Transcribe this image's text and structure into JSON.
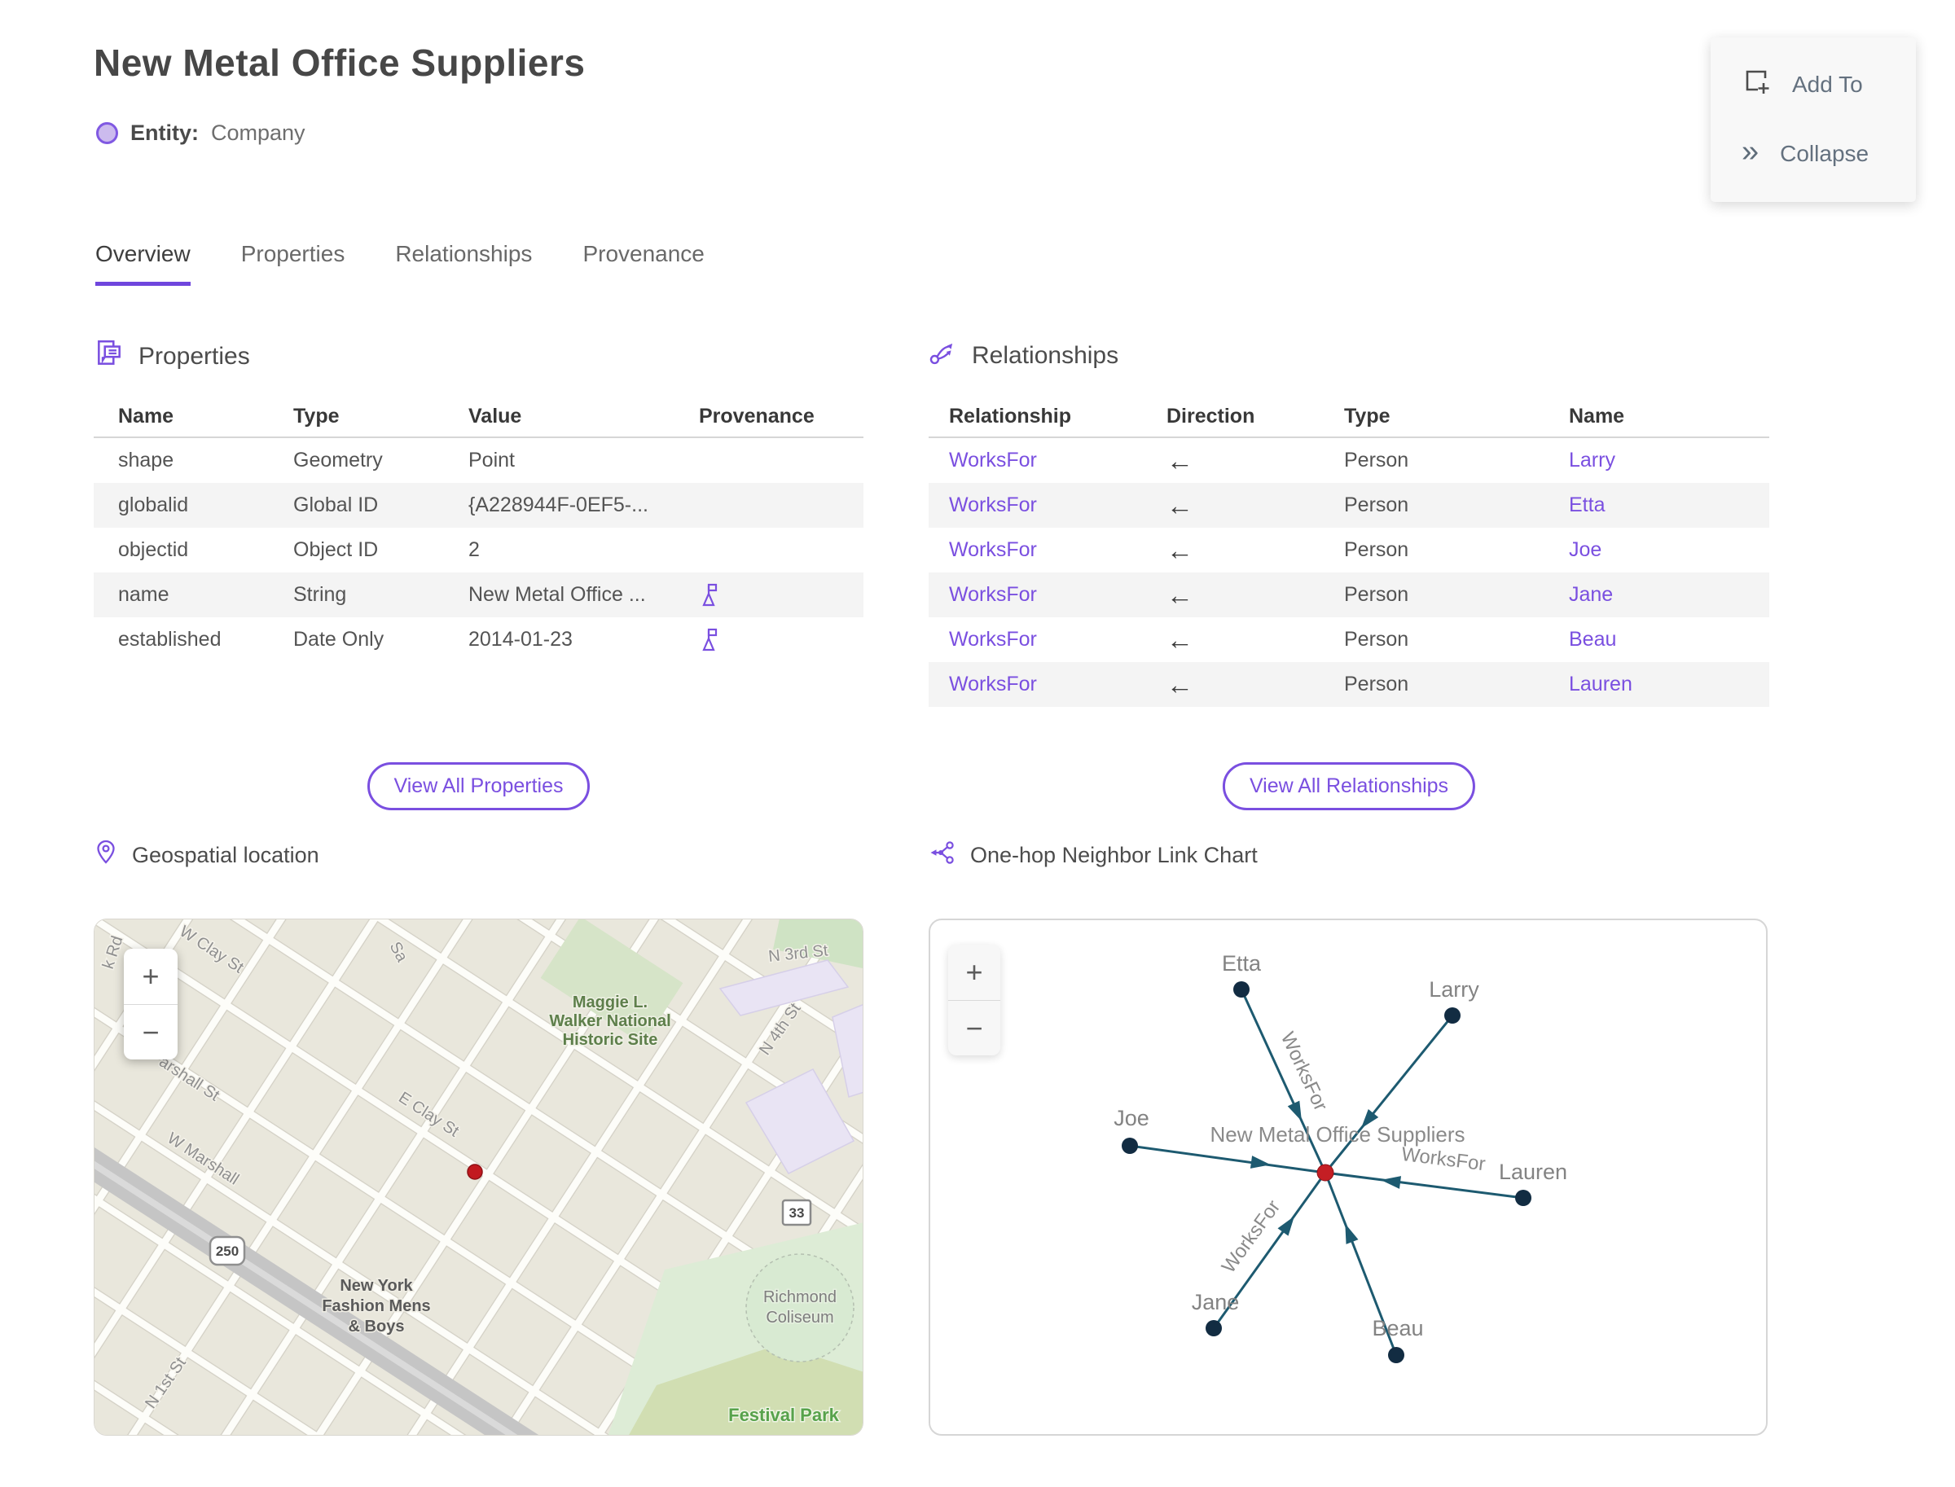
{
  "palette": {
    "accent_purple": "#7A4FE0",
    "edge_teal": "#1D5A70",
    "node_navy": "#122C42",
    "center_red": "#C41E24"
  },
  "header": {
    "title": "New Metal Office Suppliers",
    "entity_label": "Entity:",
    "entity_type": "Company"
  },
  "actions": {
    "add_to": "Add To",
    "collapse": "Collapse",
    "collapse_icon": "»"
  },
  "tabs": [
    "Overview",
    "Properties",
    "Relationships",
    "Provenance"
  ],
  "properties_section": {
    "title": "Properties",
    "columns": [
      "Name",
      "Type",
      "Value",
      "Provenance"
    ],
    "rows": [
      {
        "name": "shape",
        "type": "Geometry",
        "value": "Point"
      },
      {
        "name": "globalid",
        "type": "Global ID",
        "value": "{A228944F-0EF5-..."
      },
      {
        "name": "objectid",
        "type": "Object ID",
        "value": "2"
      },
      {
        "name": "name",
        "type": "String",
        "value": "New Metal Office ...",
        "has_provenance": true
      },
      {
        "name": "established",
        "type": "Date Only",
        "value": "2014-01-23",
        "has_provenance": true
      }
    ],
    "view_all": "View All Properties"
  },
  "relationships_section": {
    "title": "Relationships",
    "columns": [
      "Relationship",
      "Direction",
      "Type",
      "Name"
    ],
    "rows": [
      {
        "relationship": "WorksFor",
        "direction": "←",
        "type": "Person",
        "name": "Larry"
      },
      {
        "relationship": "WorksFor",
        "direction": "←",
        "type": "Person",
        "name": "Etta"
      },
      {
        "relationship": "WorksFor",
        "direction": "←",
        "type": "Person",
        "name": "Joe"
      },
      {
        "relationship": "WorksFor",
        "direction": "←",
        "type": "Person",
        "name": "Jane"
      },
      {
        "relationship": "WorksFor",
        "direction": "←",
        "type": "Person",
        "name": "Beau"
      },
      {
        "relationship": "WorksFor",
        "direction": "←",
        "type": "Person",
        "name": "Lauren"
      }
    ],
    "view_all": "View All Relationships"
  },
  "map_section": {
    "title": "Geospatial location",
    "zoom_in": "+",
    "zoom_out": "−",
    "streets": [
      "k Rd",
      "W Clay St",
      "Sa",
      "arshall St",
      "W Marshall",
      "E Clay St",
      "N 3rd St",
      "N 4th St",
      "N 1st St"
    ],
    "route_badges": [
      "250",
      "33"
    ],
    "pois": {
      "maggie": [
        "Maggie L.",
        "Walker National",
        "Historic Site"
      ],
      "ny_fashion": [
        "New York",
        "Fashion Mens",
        "& Boys"
      ],
      "coliseum": [
        "Richmond",
        "Coliseum"
      ],
      "festival_park": "Festival Park"
    }
  },
  "chart_section": {
    "title": "One-hop Neighbor Link Chart",
    "zoom_in": "+",
    "zoom_out": "−",
    "center_label": "New Metal Office Suppliers",
    "edge_label": "WorksFor",
    "nodes": [
      "Etta",
      "Larry",
      "Joe",
      "Lauren",
      "Jane",
      "Beau"
    ]
  }
}
